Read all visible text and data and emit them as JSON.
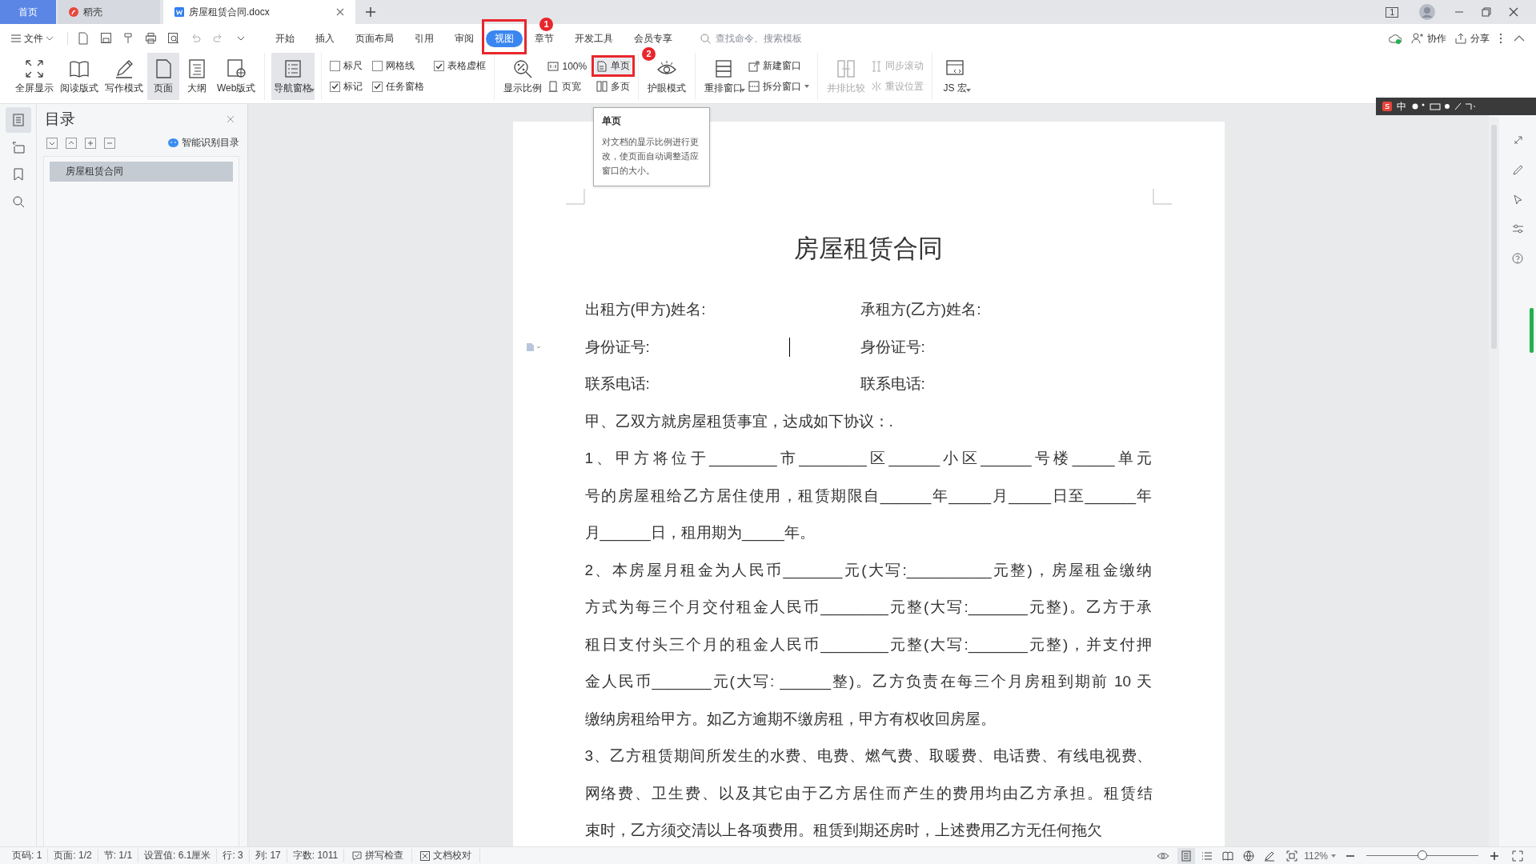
{
  "title_bar": {
    "tabs": [
      {
        "label": "首页",
        "kind": "home",
        "selected": false
      },
      {
        "label": "稻壳",
        "kind": "store",
        "selected": false
      },
      {
        "label": "房屋租赁合同.docx",
        "kind": "document",
        "selected": true
      }
    ],
    "window_count": "1"
  },
  "menu_bar": {
    "file": "文件",
    "tabs": [
      {
        "label": "开始",
        "selected": false
      },
      {
        "label": "插入",
        "selected": false
      },
      {
        "label": "页面布局",
        "selected": false
      },
      {
        "label": "引用",
        "selected": false
      },
      {
        "label": "审阅",
        "selected": false
      },
      {
        "label": "视图",
        "selected": true,
        "callout": "1"
      },
      {
        "label": "章节",
        "selected": false
      },
      {
        "label": "开发工具",
        "selected": false
      },
      {
        "label": "会员专享",
        "selected": false
      }
    ],
    "search": {
      "placeholder": "查找命令、搜索模板"
    },
    "actions": [
      "协作",
      "分享"
    ]
  },
  "ribbon": {
    "groups": [
      {
        "items": [
          {
            "kind": "big",
            "label": "全屏显示",
            "selected": false
          },
          {
            "kind": "big",
            "label": "阅读版式",
            "selected": false
          },
          {
            "kind": "big",
            "label": "写作模式",
            "selected": false
          },
          {
            "kind": "big",
            "label": "页面",
            "selected": true
          },
          {
            "kind": "big",
            "label": "大纲",
            "selected": false
          },
          {
            "kind": "big",
            "label": "Web版式",
            "selected": false
          }
        ]
      },
      {
        "items": [
          {
            "kind": "big",
            "label": "导航窗格",
            "selected": true,
            "dropdown": true
          }
        ]
      },
      {
        "items": [
          {
            "kind": "check",
            "label": "标尺",
            "checked": false
          },
          {
            "kind": "check",
            "label": "标记",
            "checked": true
          },
          {
            "kind": "check",
            "label": "网格线",
            "checked": false
          },
          {
            "kind": "check",
            "label": "任务窗格",
            "checked": true
          },
          {
            "kind": "check",
            "label": "表格虚框",
            "checked": true
          }
        ]
      },
      {
        "items": [
          {
            "kind": "big",
            "label": "显示比例",
            "selected": false
          },
          {
            "kind": "small",
            "label": "100%",
            "selected": false
          },
          {
            "kind": "small",
            "label": "页宽",
            "selected": false
          },
          {
            "kind": "small",
            "label": "单页",
            "selected": true,
            "callout": "2",
            "tooltip": {
              "title": "单页",
              "text": "对文档的显示比例进行更改，使页面自动调整适应窗口的大小。"
            }
          },
          {
            "kind": "small",
            "label": "多页",
            "selected": false
          }
        ]
      },
      {
        "items": [
          {
            "kind": "big",
            "label": "护眼模式",
            "selected": false
          }
        ]
      },
      {
        "items": [
          {
            "kind": "big",
            "label": "重排窗口",
            "selected": false,
            "dropdown": true
          },
          {
            "kind": "small",
            "label": "新建窗口",
            "selected": false
          },
          {
            "kind": "small",
            "label": "拆分窗口",
            "selected": false,
            "dropdown": true
          }
        ]
      },
      {
        "items": [
          {
            "kind": "big",
            "label": "并排比较",
            "selected": false,
            "disabled": true
          },
          {
            "kind": "small",
            "label": "同步滚动",
            "selected": false,
            "disabled": true
          },
          {
            "kind": "small",
            "label": "重设位置",
            "selected": false,
            "disabled": true
          }
        ]
      },
      {
        "items": [
          {
            "kind": "big",
            "label": "JS 宏",
            "selected": false,
            "dropdown": true
          }
        ]
      }
    ]
  },
  "side_icons": [
    {
      "selected": true
    },
    {
      "selected": false
    },
    {
      "selected": false
    },
    {
      "selected": false
    }
  ],
  "navigation_pane": {
    "title": "目录",
    "smart_toc": "智能识别目录",
    "items": [
      {
        "label": "房屋租赁合同",
        "selected": true
      }
    ]
  },
  "ime_bar": {
    "label": "中"
  },
  "document": {
    "title": "房屋租赁合同",
    "party_rows": [
      {
        "left": "出租方(甲方)姓名:",
        "right": "承租方(乙方)姓名:"
      },
      {
        "left": "身份证号:",
        "right": "身份证号:"
      },
      {
        "left": "联系电话:",
        "right": "联系电话:"
      }
    ],
    "paragraphs": [
      {
        "lines": [
          "甲、乙双方就房屋租赁事宜，达成如下协议：."
        ]
      },
      {
        "lines": [
          "1、甲方将位于________市________区______小区______号楼_____单元",
          "号的房屋租给乙方居住使用，租赁期限自______年_____月_____日至______年",
          "月______日，租用期为_____年。"
        ]
      },
      {
        "lines": [
          "2、本房屋月租金为人民币_______元(大写:__________元整)，房屋租金缴纳",
          "方式为每三个月交付租金人民币________元整(大写:_______元整)。乙方于承",
          "租日支付头三个月的租金人民币________元整(大写:_______元整)，并支付押",
          "金人民币_______元(大写: ______整)。乙方负责在每三个月房租到期前 10 天",
          "缴纳房租给甲方。如乙方逾期不缴房租，甲方有权收回房屋。"
        ]
      },
      {
        "lines": [
          "3、乙方租赁期间所发生的水费、电费、燃气费、取暖费、电话费、有线电视费、",
          "网络费、卫生费、以及其它由于乙方居住而产生的费用均由乙方承担。租赁结",
          "束时，乙方须交清以上各项费用。租赁到期还房时，上述费用乙方无任何拖欠"
        ]
      }
    ]
  },
  "status_bar": {
    "fields": [
      "页码: 1",
      "页面: 1/2",
      "节: 1/1",
      "设置值: 6.1厘米",
      "行: 3",
      "列: 17",
      "字数: 1011"
    ],
    "spell_check": "拼写检查",
    "proofread": "文档校对",
    "view_modes": [
      {
        "selected": true
      },
      {
        "selected": false
      },
      {
        "selected": false
      },
      {
        "selected": false
      },
      {
        "selected": false
      }
    ],
    "zoom": "112%",
    "zoom_slider": {
      "level": 0.5
    }
  }
}
